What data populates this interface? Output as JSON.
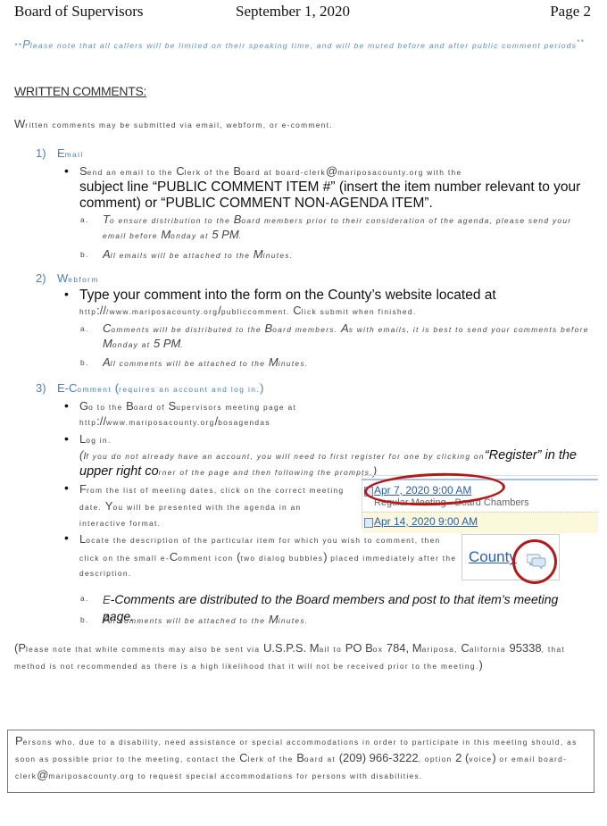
{
  "header": {
    "left": "Board of Supervisors",
    "center": "September 1, 2020",
    "right": "Page 2"
  },
  "caller_note": {
    "prefix": "**",
    "cap": "P",
    "text": "lease note that all callers will be limited on their speaking time, and will be muted before and after public comment periods",
    "suffix": "**"
  },
  "section_title": "WRITTEN COMMENTS:",
  "intro": {
    "cap": "W",
    "text": "ritten comments may be submitted via email, webform, or e-comment."
  },
  "sections": [
    {
      "number": "1)",
      "cap": "E",
      "title": "mail",
      "bullets": [
        {
          "part1_cap": "S",
          "part1": "end an email to the ",
          "part1b_cap": "C",
          "part1b": "lerk of the ",
          "part1c_cap": "B",
          "part1c": "oard at board-clerk",
          "at": "@",
          "part1d": "mariposacounty.org with the",
          "part2": "subject line “PUBLIC COMMENT ITEM #” (insert the item number relevant to your comment) or “PUBLIC COMMENT NON-AGENDA ITEM”."
        }
      ],
      "subitems": [
        {
          "label": "a.",
          "pre": "",
          "cap": "T",
          "text1": "o ensure distribution to the ",
          "cap2": "B",
          "text2": "oard members prior to their consideration of the agenda, please send your email before ",
          "cap3": "M",
          "text3": "onday at ",
          "big": "5 PM",
          "end": "."
        },
        {
          "label": "b.",
          "cap": "A",
          "text1": "ll emails will be attached to the ",
          "cap2": "M",
          "text2": "inutes."
        }
      ]
    },
    {
      "number": "2)",
      "cap": "W",
      "title": "ebform",
      "bullets": [
        {
          "line1": "Type your comment into the form on the County’s website located at",
          "url_pre": "http",
          "url_slash": "://",
          "url_mid": "/www.mariposacounty.org",
          "url_slash2": "/",
          "url_end": "publiccomment. ",
          "cap": "C",
          "tail": "lick submit when finished."
        }
      ],
      "subitems": [
        {
          "label": "a.",
          "cap": "C",
          "text1": "omments will be distributed to the ",
          "cap2": "B",
          "text2": "oard members. ",
          "cap3": "A",
          "text3": "s with emails, it is best to send your comments before ",
          "cap4": "M",
          "text4": "onday at ",
          "big": "5 PM",
          "end": "."
        },
        {
          "label": "b.",
          "cap": "A",
          "text1": "ll comments will be attached to the ",
          "cap2": "M",
          "text2": "inutes."
        }
      ]
    },
    {
      "number": "3)",
      "title_big": "E-C",
      "title": "omment ",
      "title_paren_open": "(",
      "title_rest": "requires an account and log in.",
      "title_paren_close": ")",
      "bullets": [
        {
          "cap": "G",
          "text1": "o to the ",
          "cap2": "B",
          "text2": "oard of ",
          "cap3": "S",
          "text3": "upervisors meeting page at",
          "url_pre": "http",
          "url_slash": "://",
          "url_rest": "www.mariposacounty.org",
          "url_slash2": "/",
          "url_end": "bosagendas"
        },
        {
          "cap": "L",
          "text": "og in.",
          "note_paren": "(",
          "note_cap": "I",
          "note_text": "f you do not already have an account, you will need to first register for one by clicking on",
          "note_arial": "“Register” in the upper right co",
          "note_tail": "rner of the page and then following the prompts.",
          "note_close": ")"
        },
        {
          "cap": "F",
          "text1": "rom the list of meeting dates, click on the correct meeting date. ",
          "cap2": "Y",
          "text2": "ou will be presented with the agenda in an interactive format."
        },
        {
          "cap": "L",
          "text1": "ocate the description of the particular item for which you wish to comment, then click on the small e-",
          "cap2": "C",
          "text2": "omment icon ",
          "paren_open": "(",
          "text3": "two dialog bubbles",
          "paren_close": ")",
          "text4": " placed immediately after the description."
        }
      ],
      "subitems": [
        {
          "label": "a.",
          "cap": "E",
          "arial": "-Comments are distributed to the Board members and post to that item’s meeting page."
        },
        {
          "label": "b.",
          "cap": "A",
          "text1": "ll comments will be attached to the ",
          "cap2": "M",
          "text2": "inutes."
        }
      ]
    }
  ],
  "meeting_list_screenshot": {
    "row1_date": "Apr 7, 2020 9:00 AM",
    "row1_sub": "Regular Meeting - Board Chambers",
    "row2_date": "Apr 14, 2020 9:00 AM"
  },
  "ecomment_screenshot": {
    "link_text": "County",
    "icon": "two-dialog-bubbles-icon"
  },
  "mail_note": {
    "open": "(",
    "cap": "P",
    "text1": "lease note that while comments may also be sent via ",
    "big1": "U.S.P.S. M",
    "text2": "ail to ",
    "big2": "PO B",
    "text3": "ox ",
    "big3": "784, M",
    "text4": "ariposa, ",
    "big4": "C",
    "text5": "alifornia ",
    "big5": "95338",
    "text6": ", that method is not recommended as there is a high likelihood that it will not be received prior to the meeting.",
    "close": ")"
  },
  "accessibility_box": {
    "cap": "P",
    "text1": "ersons who, due to a disability, need assistance or special accommodations in order to participate in this meeting should, as soon as possible prior to the meeting, contact the ",
    "cap2": "C",
    "text2": "lerk of the ",
    "cap3": "B",
    "text3": "oard at ",
    "phone": "(209) 966-3222",
    "text4": ", option ",
    "big_two": "2",
    "text5": " ",
    "paren_open": "(",
    "voice": "voice",
    "paren_close": ")",
    "text6": " or email board-clerk",
    "at": "@",
    "text7": "mariposacounty.org to request special accommodations for persons with disabilities."
  },
  "colors": {
    "accent_blue": "#4a80b4",
    "note_blue": "#5a8fc0",
    "link_blue": "#2b5fa6",
    "highlight_red": "#b01a1a"
  }
}
